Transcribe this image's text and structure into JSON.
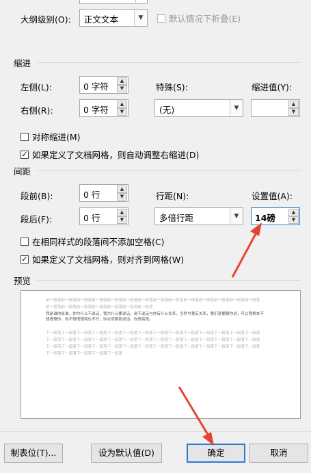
{
  "outline": {
    "label": "大纲级别(O):",
    "value": "正文文本",
    "collapse_label": "默认情况下折叠(E)"
  },
  "indent": {
    "title": "缩进",
    "left_label": "左侧(L):",
    "left_value": "0 字符",
    "right_label": "右侧(R):",
    "right_value": "0 字符",
    "special_label": "特殊(S):",
    "special_value": "(无)",
    "indent_value_label": "缩进值(Y):",
    "indent_value": "",
    "mirror_label": "对称缩进(M)",
    "auto_adjust_label": "如果定义了文档网格，则自动调整右缩进(D)"
  },
  "spacing": {
    "title": "间距",
    "before_label": "段前(B):",
    "before_value": "0 行",
    "after_label": "段后(F):",
    "after_value": "0 行",
    "line_label": "行距(N):",
    "line_value": "多倍行距",
    "setting_label": "设置值(A):",
    "setting_value": "14磅",
    "no_space_label": "在相同样式的段落间不添加空格(C)",
    "snap_grid_label": "如果定义了文档网格，则对齐到网格(W)"
  },
  "preview": {
    "title": "预览",
    "prev_1": "前一段落前一段落前一段落前一段落前一段落前一段落前一段落前一段落前一段落前一段落前一段落前一段落前一段落前一段落",
    "prev_2": "前一段落前一段落前一段落前一段落前一段落前一段落前一段落",
    "sample": "我是谁你是谁，你为什么不说话，我为什么要说话，说不说话与你有什么关系，当然与我有关系，我们就要跟你说，可以我根本不想搭理你，你不想搭理我也不行，你必须跟我说话，你想搞鬼。",
    "next_1": "下一段落下一段落下一段落下一段落下一段落下一段落下一段落下一段落下一段落下一段落下一段落下一段落下一段落下一段落",
    "next_2": "下一段落下一段落下一段落下一段落下一段落下一段落下一段落下一段落下一段落下一段落下一段落下一段落下一段落下一段落",
    "next_3": "下一段落下一段落下一段落下一段落下一段落下一段落下一段落下一段落下一段落下一段落下一段落下一段落下一段落下一段落",
    "next_4": "下一段落下一段落下一段落下一段落下一段落"
  },
  "buttons": {
    "tabs": "制表位(T)...",
    "set_default": "设为默认值(D)",
    "ok": "确定",
    "cancel": "取消"
  },
  "colors": {
    "accent": "#2a7bd4",
    "annotation_arrow": "#e8432e"
  },
  "icons": {
    "spin_up": "▲",
    "spin_down": "▼",
    "dropdown": "▼",
    "check": "✓"
  }
}
